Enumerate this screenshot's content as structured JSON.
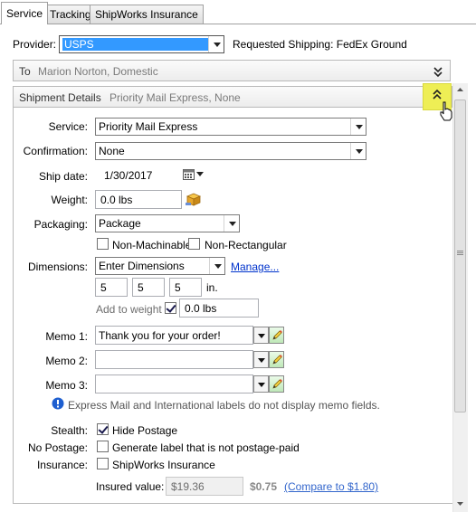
{
  "tabs": [
    {
      "label": "Service"
    },
    {
      "label": "Tracking"
    },
    {
      "label": "ShipWorks Insurance"
    }
  ],
  "provider": {
    "label": "Provider:",
    "value": "USPS",
    "requested_label": "Requested Shipping: FedEx Ground"
  },
  "to_section": {
    "title": "To",
    "subtitle": "Marion Norton, Domestic"
  },
  "shipment_section": {
    "title": "Shipment Details",
    "subtitle": "Priority Mail Express, None"
  },
  "fields": {
    "service": {
      "label": "Service:",
      "value": "Priority Mail Express"
    },
    "confirmation": {
      "label": "Confirmation:",
      "value": "None"
    },
    "ship_date": {
      "label": "Ship date:",
      "value": "1/30/2017"
    },
    "weight": {
      "label": "Weight:",
      "value": "0.0 lbs"
    },
    "packaging": {
      "label": "Packaging:",
      "value": "Package"
    },
    "non_machinable": {
      "label": "Non-Machinable",
      "checked": false
    },
    "non_rectangular": {
      "label": "Non-Rectangular",
      "checked": false
    },
    "dimensions": {
      "label": "Dimensions:",
      "value": "Enter Dimensions",
      "manage_link": "Manage...",
      "length": "5",
      "width": "5",
      "height": "5",
      "unit": "in."
    },
    "add_to_weight": {
      "label": "Add to weight",
      "checked": true,
      "value": "0.0 lbs"
    },
    "memo1": {
      "label": "Memo 1:",
      "value": "Thank you for your order!"
    },
    "memo2": {
      "label": "Memo 2:",
      "value": ""
    },
    "memo3": {
      "label": "Memo 3:",
      "value": ""
    },
    "memo_notice": "Express Mail and International labels do not display memo fields.",
    "stealth": {
      "label": "Stealth:",
      "option": "Hide Postage",
      "checked": true
    },
    "no_postage": {
      "label": "No Postage:",
      "option": "Generate label that is not postage-paid",
      "checked": false
    },
    "insurance": {
      "label": "Insurance:",
      "option": "ShipWorks Insurance",
      "checked": false
    },
    "insured_value": {
      "label": "Insured value:",
      "value": "$19.36",
      "cost": "$0.75",
      "compare_link": "(Compare to $1.80)"
    }
  },
  "colors": {
    "accent": "#3399ff",
    "highlight": "#f0f060",
    "link": "#0033cc",
    "info": "#1e5fd0"
  }
}
